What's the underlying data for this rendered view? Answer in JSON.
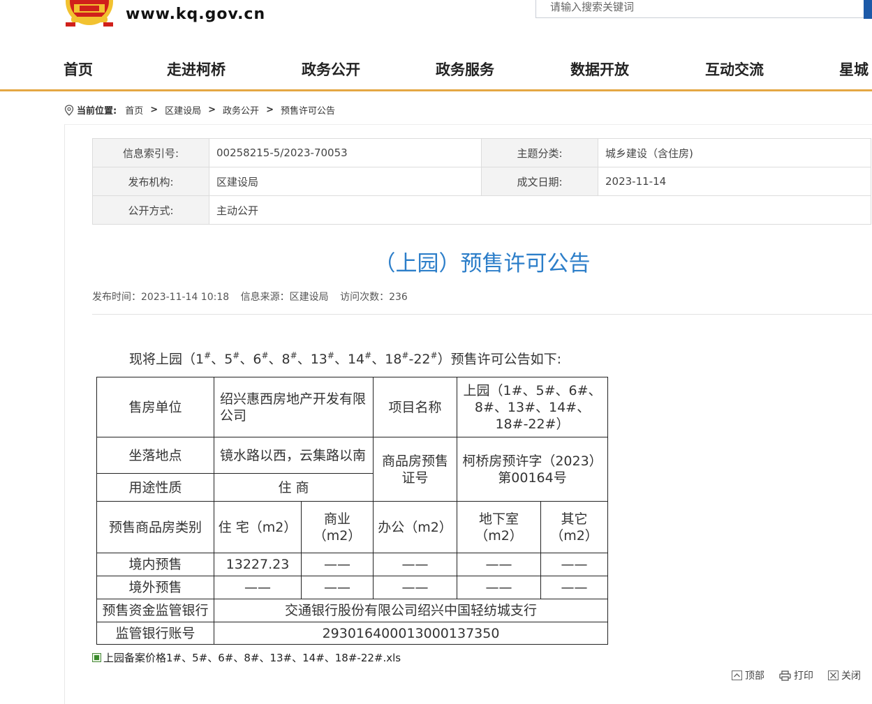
{
  "header": {
    "domain": "www.kq.gov.cn",
    "search_placeholder": "请输入搜索关键词"
  },
  "nav": [
    {
      "label": "首页"
    },
    {
      "label": "走进柯桥"
    },
    {
      "label": "政务公开"
    },
    {
      "label": "政务服务"
    },
    {
      "label": "数据开放"
    },
    {
      "label": "互动交流"
    },
    {
      "label": "星城"
    }
  ],
  "breadcrumb": {
    "label": "当前位置:",
    "items": [
      "首页",
      "区建设局",
      "政务公开",
      "预售许可公告"
    ],
    "separator": ">"
  },
  "meta": {
    "index_label": "信息索引号:",
    "index_value": "00258215-5/2023-70053",
    "topic_label": "主题分类:",
    "topic_value": "城乡建设（含住房)",
    "publisher_label": "发布机构:",
    "publisher_value": "区建设局",
    "date_label": "成文日期:",
    "date_value": "2023-11-14",
    "disclosure_label": "公开方式:",
    "disclosure_value": "主动公开"
  },
  "article": {
    "title": "（上园）预售许可公告",
    "publish_time": "发布时间：2023-11-14 10:18",
    "source": "信息来源：区建设局",
    "visits": "访问次数：236"
  },
  "intro": {
    "lead": "现将上园（",
    "buildings": [
      "1",
      "5",
      "6",
      "8",
      "13",
      "14",
      "18",
      "-22"
    ],
    "tail": "）预售许可公告如下:"
  },
  "presale_table": {
    "seller_label": "售房单位",
    "seller_value": "绍兴惠西房地产开发有限公司",
    "project_label": "项目名称",
    "project_value": "上园（1#、5#、6#、8#、13#、14#、18#-22#）",
    "location_label": "坐落地点",
    "location_value": "镜水路以西，云集路以南",
    "cert_label": "商品房预售证号",
    "cert_value": "柯桥房预许字（2023）第00164号",
    "usage_label": "用途性质",
    "usage_value": "住  商",
    "category_label": "预售商品房类别",
    "col_residential": "住 宅（m2）",
    "col_commercial": "商业（m2）",
    "col_office": "办公（m2）",
    "col_basement": "地下室（m2）",
    "col_other": "其它（m2）",
    "domestic_label": "境内预售",
    "domestic_values": [
      "13227.23",
      "——",
      "——",
      "——",
      "——"
    ],
    "foreign_label": "境外预售",
    "foreign_values": [
      "——",
      "——",
      "——",
      "——",
      "——"
    ],
    "bank_label": "预售资金监管银行",
    "bank_value": "交通银行股份有限公司绍兴中国轻纺城支行",
    "account_label": "监管银行账号",
    "account_value": "293016400013000137350"
  },
  "attachment": {
    "filename": "上园备案价格1#、5#、6#、8#、13#、14#、18#-22#.xls",
    "icon": "excel-file-icon"
  },
  "tools": {
    "top_label": "顶部",
    "print_label": "打印",
    "close_label": "关闭"
  },
  "colors": {
    "title_blue": "#2c7ec9",
    "nav_underline": "#e4a744",
    "emblem_red": "#d0201b",
    "emblem_gold": "#f2c230"
  }
}
